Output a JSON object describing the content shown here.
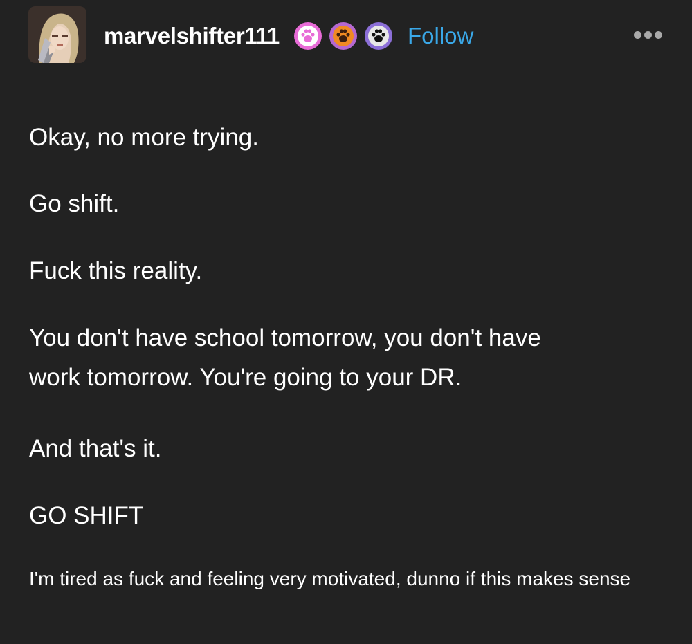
{
  "post": {
    "author": {
      "username": "marvelshifter111",
      "avatar_icon": "avatar-image",
      "badges": [
        {
          "icon": "paw-badge-icon",
          "color": "#e86bd7"
        },
        {
          "icon": "paw-badge-icon",
          "color": "#f08a22"
        },
        {
          "icon": "paw-badge-icon",
          "color": "#8c6fd8"
        }
      ]
    },
    "follow_label": "Follow",
    "more_icon": "ellipsis-icon",
    "paragraphs": [
      "Okay, no more trying.",
      "Go shift.",
      "Fuck this reality.",
      "You don't have school tomorrow, you don't have",
      "work tomorrow. You're going to your DR.",
      "And that's it.",
      "GO SHIFT"
    ],
    "small_text": "I'm tired as fuck and feeling very motivated, dunno if this makes sense"
  },
  "colors": {
    "background": "#222222",
    "text": "#ffffff",
    "follow": "#3aa8e8",
    "more_icon": "#a9a9a9"
  }
}
